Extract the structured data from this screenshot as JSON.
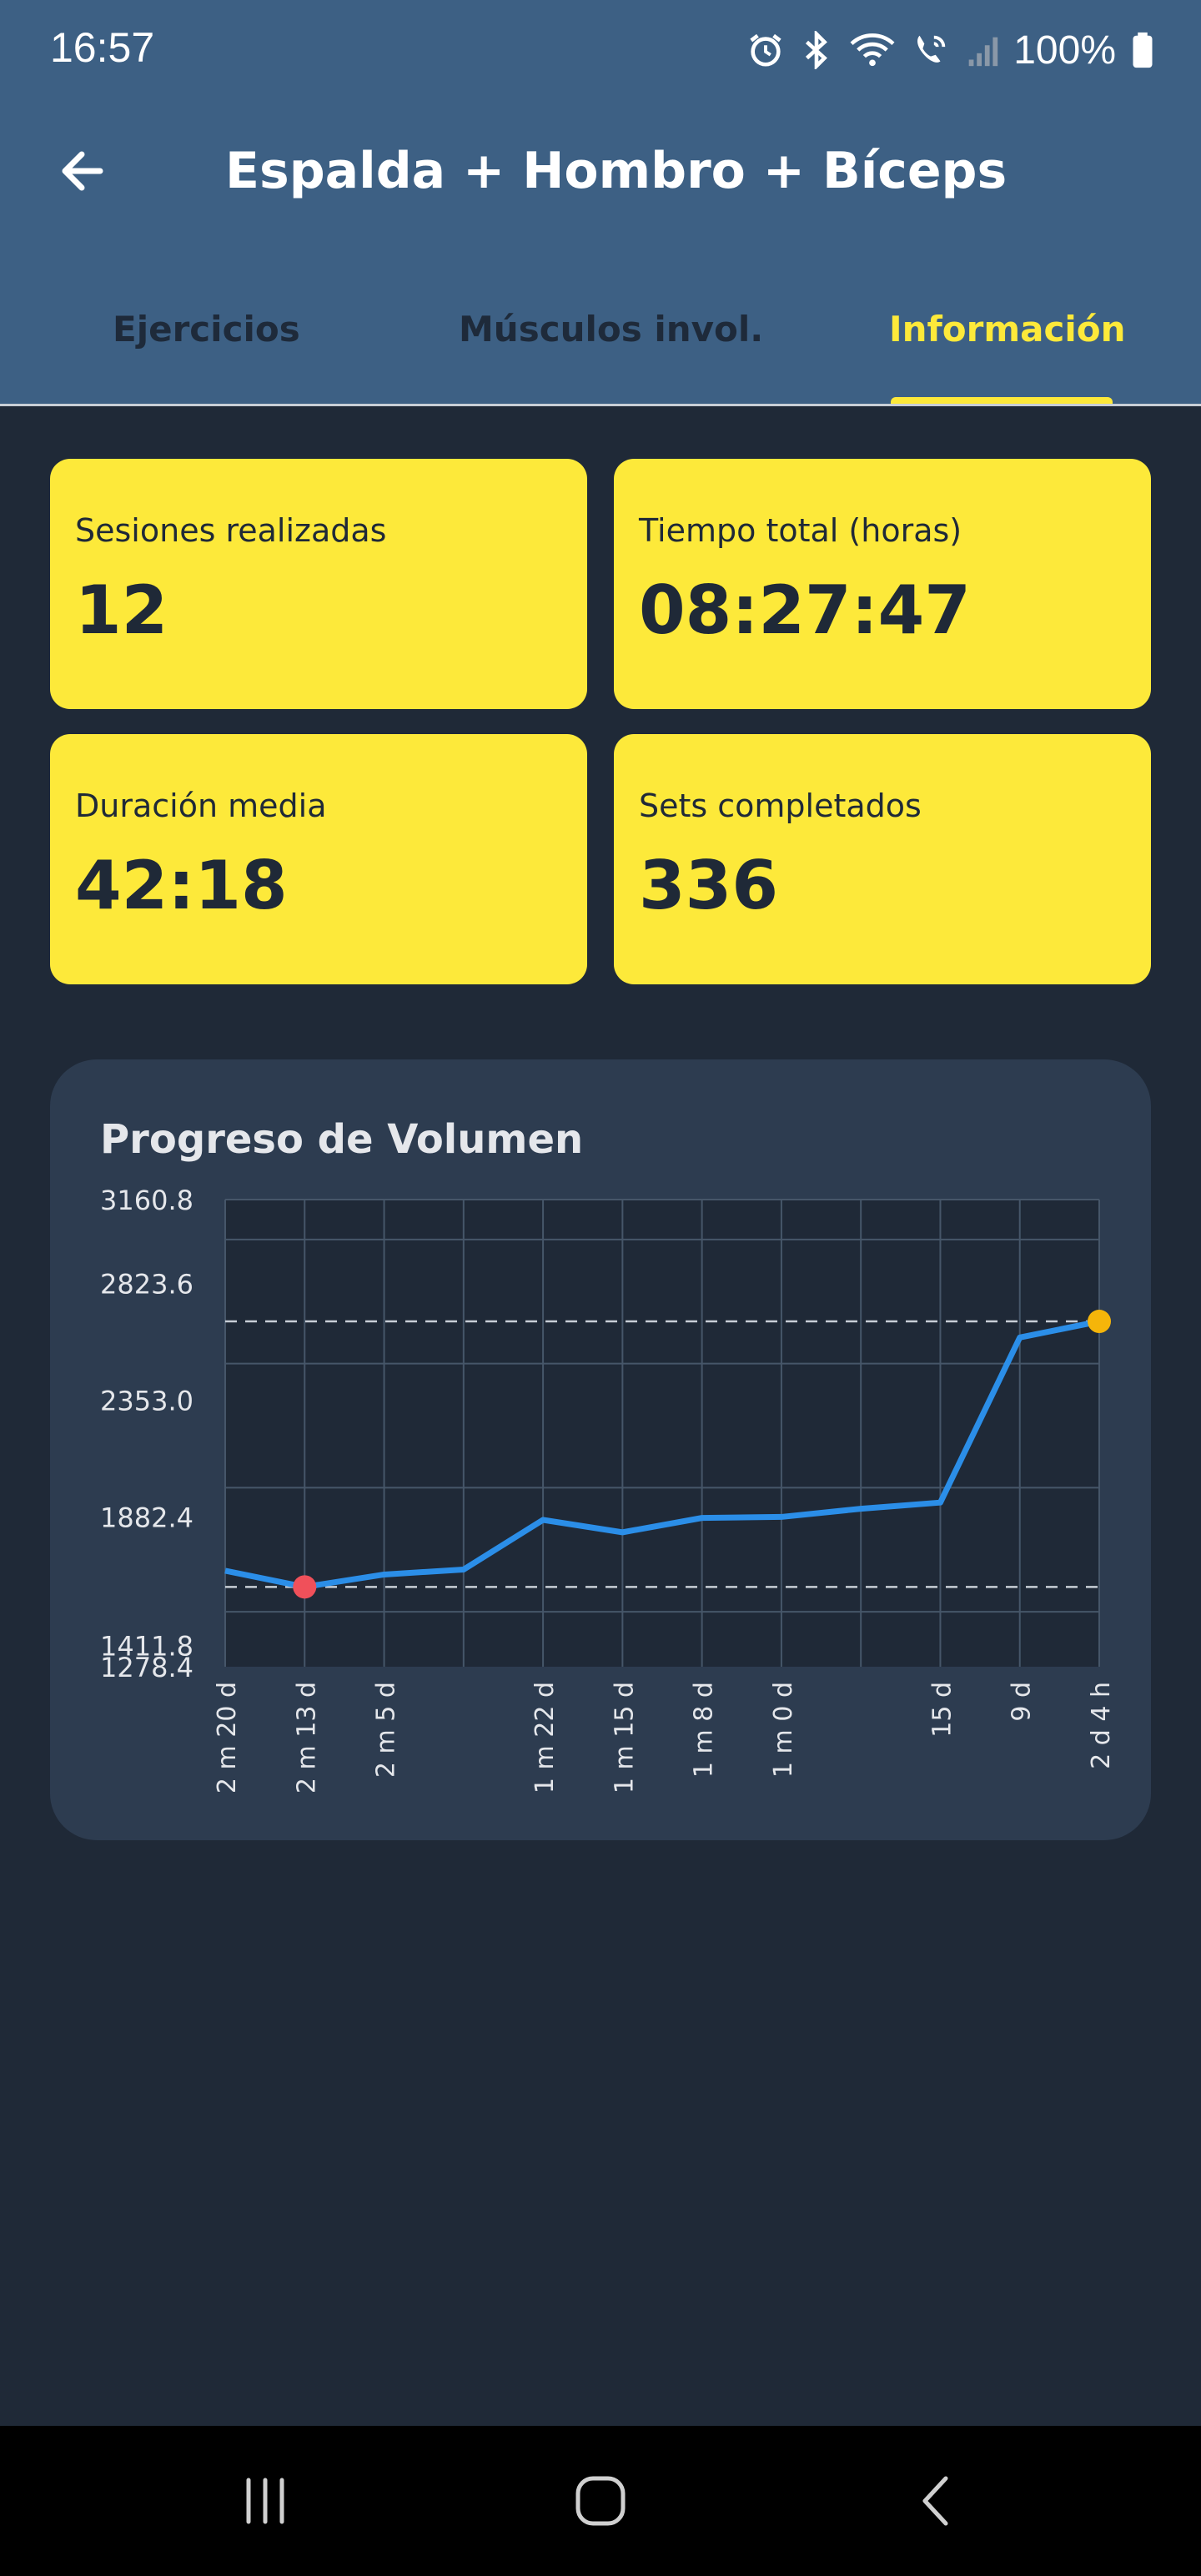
{
  "status_bar": {
    "time": "16:57",
    "battery": "100%",
    "icons": [
      "alarm-icon",
      "bluetooth-icon",
      "wifi-icon",
      "wifi-calling-icon",
      "signal-icon",
      "battery-icon"
    ]
  },
  "app_bar": {
    "title": "Espalda + Hombro + Bíceps",
    "back_icon": "arrow-left-icon"
  },
  "tabs": [
    {
      "label": "Ejercicios",
      "active": false
    },
    {
      "label": "Músculos invol.",
      "active": false
    },
    {
      "label": "Información",
      "active": true
    }
  ],
  "stats": [
    {
      "label": "Sesiones realizadas",
      "value": "12"
    },
    {
      "label": "Tiempo total (horas)",
      "value": "08:27:47"
    },
    {
      "label": "Duración media",
      "value": "42:18"
    },
    {
      "label": "Sets completados",
      "value": "336"
    }
  ],
  "colors": {
    "header": "#3d6084",
    "background": "#1f2937",
    "accent": "#fde93a",
    "card": "#2d3c50",
    "line": "#2b8ee8",
    "min_marker": "#f0505a",
    "max_marker": "#f5b50a"
  },
  "chart_data": {
    "type": "line",
    "title": "Progreso de Volumen",
    "y_tick_labels": [
      "3160.8",
      "2823.6",
      "2353.0",
      "1882.4",
      "1411.8",
      "1278.4"
    ],
    "ylim": [
      1278.4,
      3160.8
    ],
    "x_tick_labels": [
      "2 m 20 d",
      "2 m 13 d",
      "2 m 5 d",
      "",
      "1 m 22 d",
      "1 m 15 d",
      "1 m 8 d",
      "1 m 0 d",
      "",
      "15 d",
      "9 d",
      "2 d 4 h"
    ],
    "series": [
      {
        "values": [
          1665,
          1600,
          1650,
          1670,
          1870,
          1820,
          1878,
          1882,
          1915,
          1940,
          2605,
          2670
        ]
      }
    ],
    "reference_lines": [
      2670,
      1600
    ],
    "min_index": 1,
    "max_index": 11,
    "grid": true,
    "legend": "none"
  },
  "nav_bar": {
    "buttons": [
      "recent-apps-icon",
      "home-icon",
      "back-icon"
    ]
  }
}
